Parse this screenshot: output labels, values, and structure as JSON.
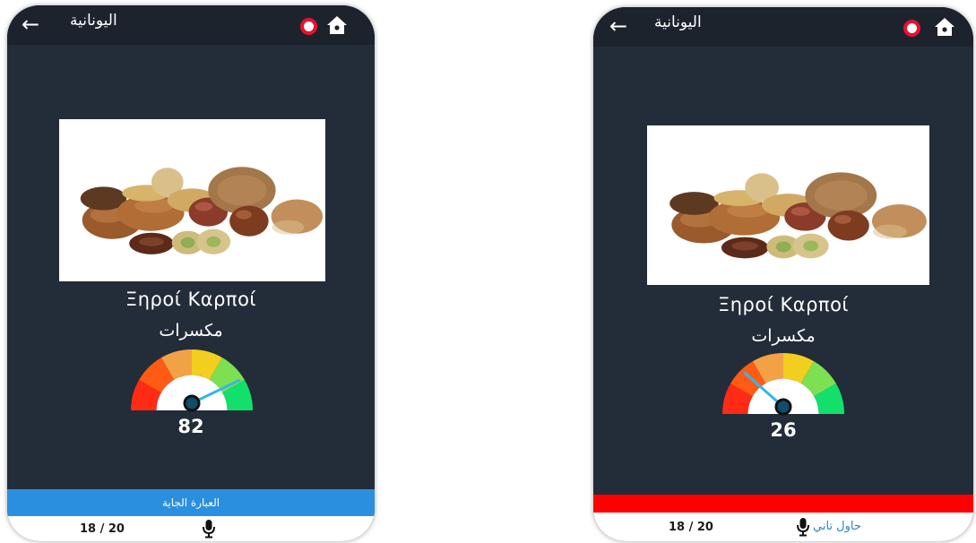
{
  "colors": {
    "screen_bg": "#232c39",
    "topbar_bg": "#1c232d",
    "success_bar": "#2b8fe0",
    "fail_bar": "#ff0000",
    "gauge_needle": "#34b6e8",
    "reload_icon": "#e8112d",
    "retry_link": "#2a86c8"
  },
  "screens": [
    {
      "header": {
        "title": "اليونانية",
        "back_icon": "arrow-left-icon",
        "reload_icon": "circle-icon",
        "home_icon": "home-icon"
      },
      "word": {
        "greek": "Ξηροί Καρποί",
        "arabic": "مكسرات"
      },
      "score": {
        "value": 82,
        "label": "82",
        "max": 100
      },
      "feedback": {
        "label": "العبارة الجاية",
        "status": "success"
      },
      "footer": {
        "progress": "18 / 20",
        "mic_icon": "microphone-icon"
      }
    },
    {
      "header": {
        "title": "اليونانية",
        "back_icon": "arrow-left-icon",
        "reload_icon": "circle-icon",
        "home_icon": "home-icon"
      },
      "word": {
        "greek": "Ξηροί Καρποί",
        "arabic": "مكسرات"
      },
      "score": {
        "value": 26,
        "label": "26",
        "max": 100
      },
      "feedback": {
        "label": "",
        "status": "fail"
      },
      "footer": {
        "progress": "18 / 20",
        "retry": "حاول تاني",
        "mic_icon": "microphone-icon"
      }
    }
  ]
}
